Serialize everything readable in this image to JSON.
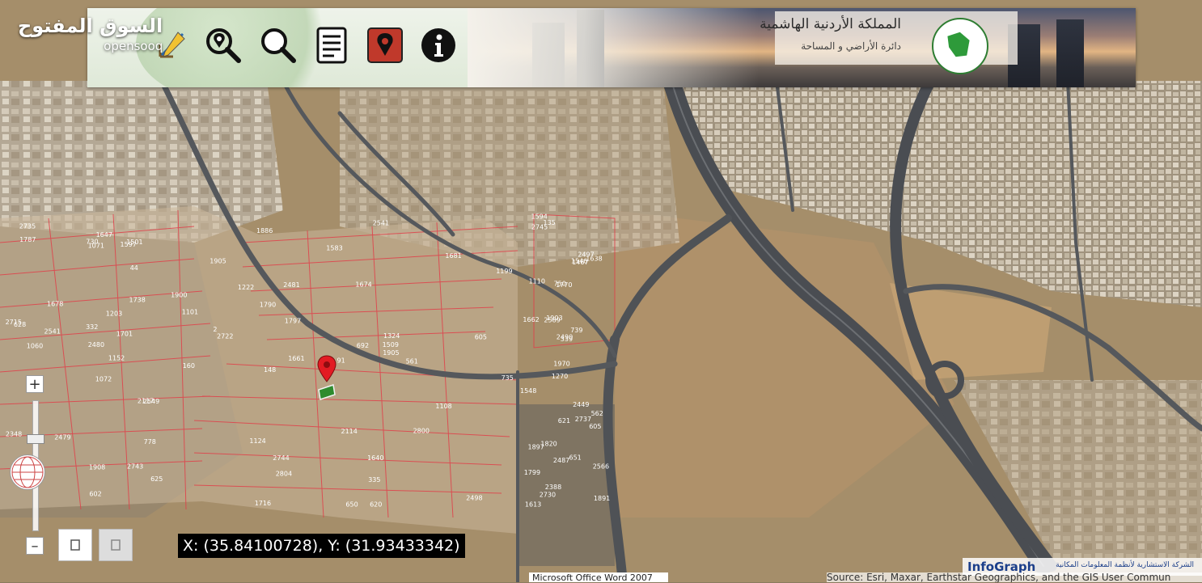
{
  "watermark": {
    "arabic": "السوق المفتوح",
    "latin": "opensooq"
  },
  "banner": {
    "title": "المملكة الأردنية الهاشمية",
    "subtitle": "دائرة الأراضي و المساحة"
  },
  "toolbar": {
    "tools": [
      {
        "name": "measure-tool",
        "icon": "ruler-pencil-icon"
      },
      {
        "name": "locate-tool",
        "icon": "location-search-icon"
      },
      {
        "name": "search-tool",
        "icon": "magnifier-icon"
      },
      {
        "name": "report-tool",
        "icon": "document-icon"
      },
      {
        "name": "place-marker-tool",
        "icon": "map-pin-icon"
      },
      {
        "name": "info-tool",
        "icon": "info-icon"
      }
    ]
  },
  "map_controls": {
    "zoom_in_label": "+",
    "zoom_out_label": "–"
  },
  "coordinates": "X: (35.84100728), Y: (31.93433342)",
  "attribution": "Source: Esri, Maxar, Earthstar Geographics, and the GIS User Commun",
  "taskbar_label": "Microsoft Office Word 2007",
  "infograph": {
    "name": "InfoGraph",
    "arabic": "الشركة الاستشارية لأنظمة المعلومات المكانية"
  },
  "parcel_labels": [
    "1072",
    "1222",
    "1970",
    "80",
    "1324",
    "1820",
    "1501",
    "1674",
    "1467",
    "1152",
    "1886",
    "1891",
    "1060",
    "1199",
    "1270",
    "1738",
    "1716",
    "750",
    "1203",
    "1124",
    "1903",
    "1211",
    "2804",
    "1770",
    "1701",
    "1108",
    "1110",
    "1071",
    "2722",
    "2449",
    "1101",
    "91",
    "2487",
    "2480",
    "2481",
    "2497",
    "2479",
    "2498",
    "2566",
    "2549",
    "2541",
    "2589",
    "2541",
    "2800",
    "2730",
    "2715",
    "1509",
    "1613",
    "1908",
    "1905",
    "1897",
    "1900",
    "1905",
    "2737",
    "2743",
    "2744",
    "2745",
    "2735",
    "1640",
    "1638",
    "1647",
    "1661",
    "1662",
    "1678",
    "1681",
    "1594",
    "1597",
    "1583",
    "2490",
    "2348",
    "2114",
    "2388",
    "2117",
    "1797",
    "1799",
    "1787",
    "1790",
    "1548",
    "332",
    "335",
    "339",
    "349",
    "561",
    "562",
    "602",
    "605",
    "621",
    "625",
    "620",
    "651",
    "730",
    "735",
    "739",
    "778",
    "692",
    "605",
    "628",
    "650",
    "1546",
    "44",
    "148",
    "135",
    "160",
    "2"
  ]
}
